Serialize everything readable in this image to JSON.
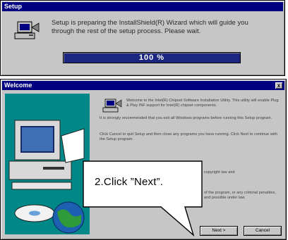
{
  "setup_window": {
    "title": "Setup",
    "message": "Setup is preparing the InstallShield(R) Wizard which will guide you through the rest of the setup process. Please wait.",
    "progress_text": "100 %",
    "progress_fraction": 1.0
  },
  "welcome_window": {
    "title": "Welcome",
    "close_label": "x",
    "paragraphs": [
      "Welcome to the Intel(R) Chipset Software Installation Utility. This utility will enable Plug & Play INF support for Intel(R) chipset components.",
      "It is strongly recommended that you exit all Windows programs before running this Setup program.",
      "Click Cancel to quit Setup and then close any programs you have running. Click Next to continue with the Setup program.",
      "copyright law and",
      "of the program, or any criminal penalties, and possible under law."
    ],
    "next_label": "Next >",
    "cancel_label": "Cancel"
  },
  "callout": {
    "text": "2.Click ”Next”."
  },
  "colors": {
    "titlebar": "#000080",
    "window_face": "#c6c6c6",
    "progress_fill": "#1a2680",
    "art_background": "#008888"
  }
}
